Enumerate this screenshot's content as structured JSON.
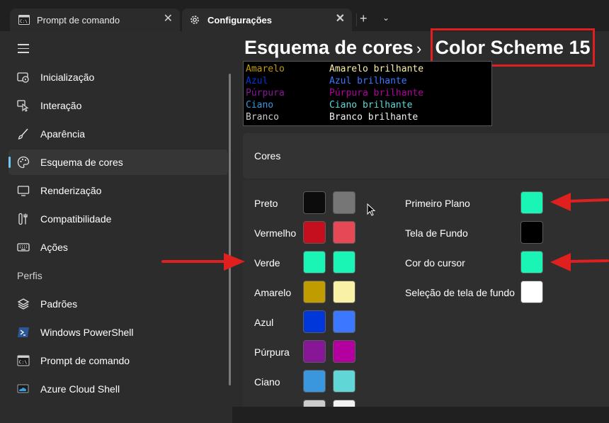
{
  "tabs": [
    {
      "label": "Prompt de comando",
      "icon": "terminal-icon"
    },
    {
      "label": "Configurações",
      "icon": "gear-icon"
    }
  ],
  "nav": {
    "items": [
      {
        "label": "Inicialização",
        "icon": "startup-icon"
      },
      {
        "label": "Interação",
        "icon": "interaction-icon"
      },
      {
        "label": "Aparência",
        "icon": "brush-icon"
      },
      {
        "label": "Esquema de cores",
        "icon": "palette-icon",
        "selected": true
      },
      {
        "label": "Renderização",
        "icon": "monitor-icon"
      },
      {
        "label": "Compatibilidade",
        "icon": "tools-icon"
      },
      {
        "label": "Ações",
        "icon": "keyboard-icon"
      }
    ],
    "profiles_header": "Perfis",
    "profiles": [
      {
        "label": "Padrões",
        "icon": "layers-icon"
      },
      {
        "label": "Windows PowerShell",
        "icon": "powershell-icon"
      },
      {
        "label": "Prompt de comando",
        "icon": "cmd-icon"
      },
      {
        "label": "Azure Cloud Shell",
        "icon": "azure-icon"
      }
    ]
  },
  "breadcrumb": {
    "parent": "Esquema de cores",
    "separator": "›",
    "current": "Color Scheme 15"
  },
  "preview": [
    {
      "left": "Amarelo",
      "right": "Amarelo brilhante",
      "left_color": "#c19c00",
      "right_color": "#f9f1a5"
    },
    {
      "left": "Azul",
      "right": "Azul brilhante",
      "left_color": "#0037da",
      "right_color": "#3b78ff"
    },
    {
      "left": "Púrpura",
      "right": "Púrpura brilhante",
      "left_color": "#881798",
      "right_color": "#b4009e"
    },
    {
      "left": "Ciano",
      "right": "Ciano brilhante",
      "left_color": "#3a96dd",
      "right_color": "#61d6d6"
    },
    {
      "left": "Branco",
      "right": "Branco brilhante",
      "left_color": "#cccccc",
      "right_color": "#f2f2f2"
    }
  ],
  "cores_title": "Cores",
  "colors": [
    {
      "name": "Preto",
      "normal": "#0c0c0c",
      "bright": "#767676"
    },
    {
      "name": "Vermelho",
      "normal": "#c50f1f",
      "bright": "#e74856"
    },
    {
      "name": "Verde",
      "normal": "#1af5b6",
      "bright": "#1af5b6"
    },
    {
      "name": "Amarelo",
      "normal": "#c19c00",
      "bright": "#f9f1a5"
    },
    {
      "name": "Azul",
      "normal": "#0037da",
      "bright": "#3b78ff"
    },
    {
      "name": "Púrpura",
      "normal": "#881798",
      "bright": "#b4009e"
    },
    {
      "name": "Ciano",
      "normal": "#3a96dd",
      "bright": "#61d6d6"
    },
    {
      "name": "",
      "normal": "#cccccc",
      "bright": "#f2f2f2"
    }
  ],
  "special_colors": [
    {
      "name": "Primeiro Plano",
      "color": "#1af5b6"
    },
    {
      "name": "Tela de Fundo",
      "color": "#000000"
    },
    {
      "name": "Cor do cursor",
      "color": "#1af5b6"
    },
    {
      "name": "Seleção de tela de fundo",
      "color": "#ffffff"
    }
  ],
  "accent_color": "#6dc8f2",
  "annotation_color": "#e01f1f"
}
